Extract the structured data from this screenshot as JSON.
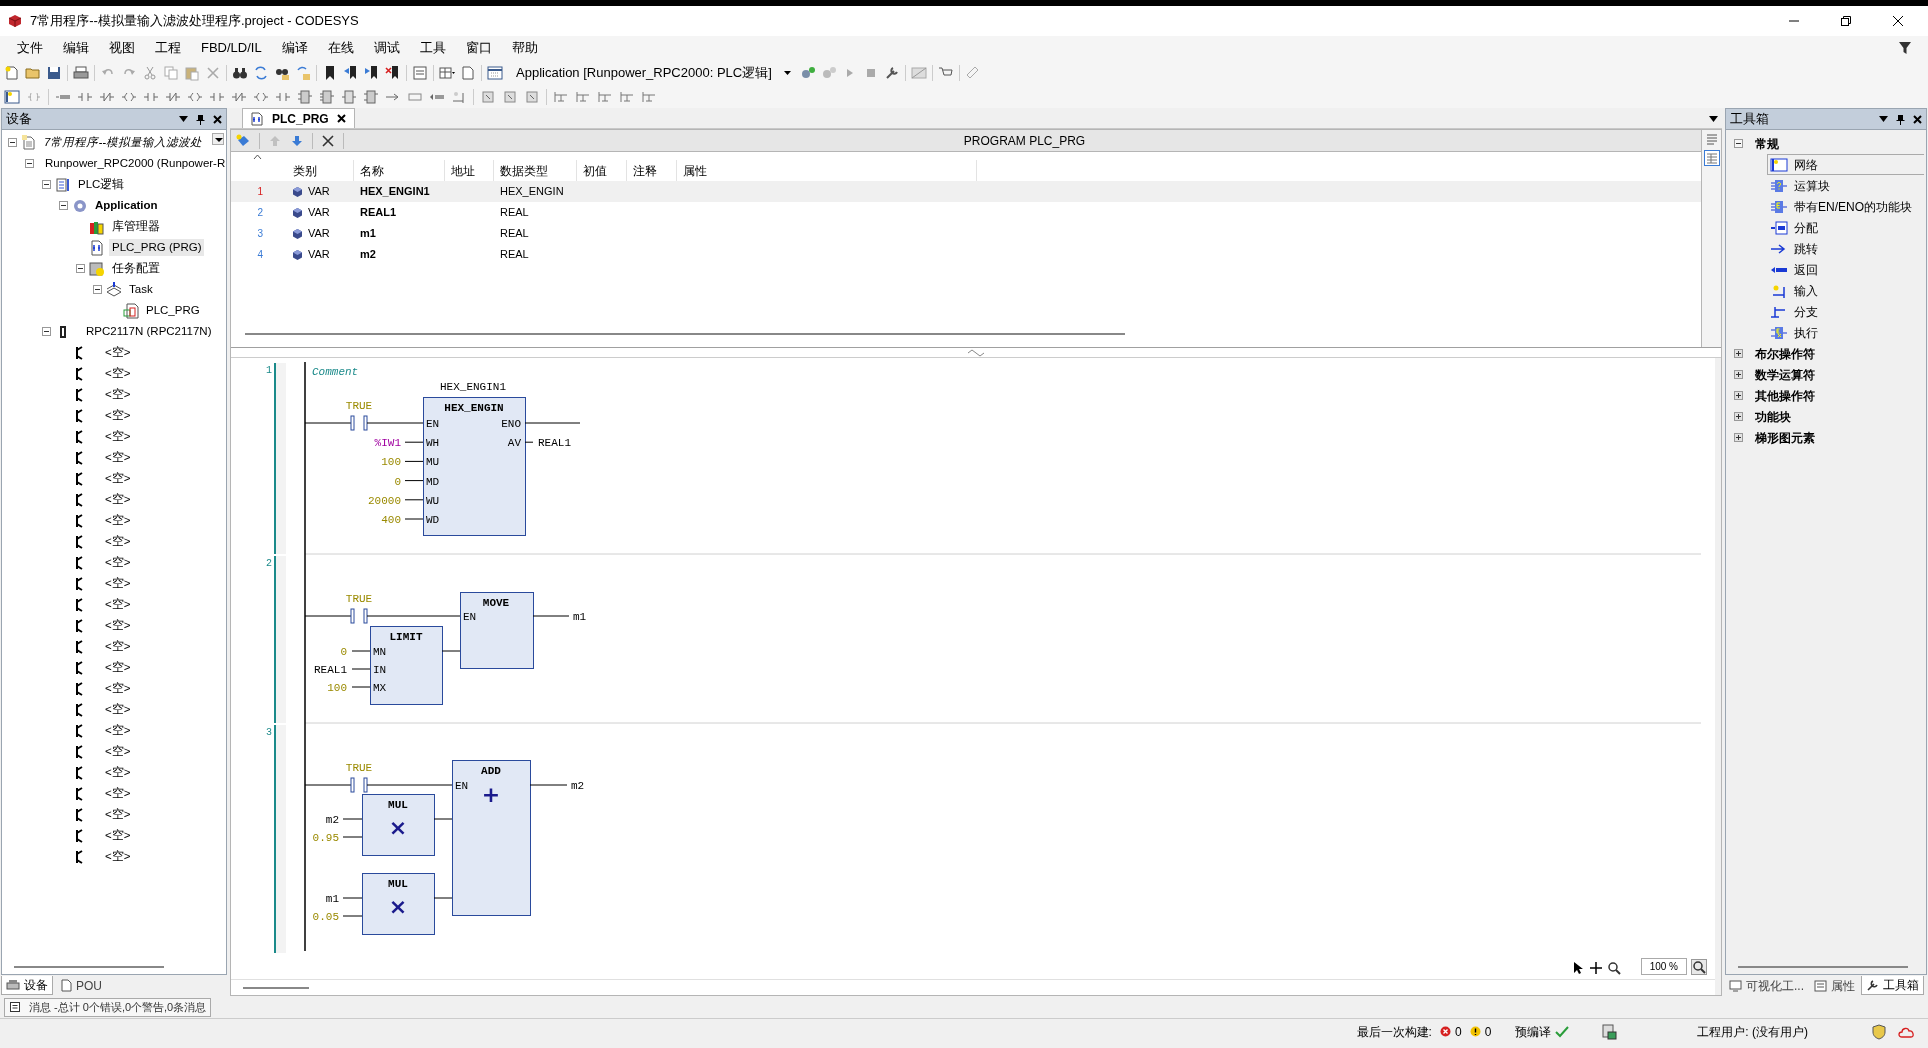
{
  "window": {
    "title": "7常用程序--模拟量输入滤波处理程序.project - CODESYS"
  },
  "menu": [
    "文件",
    "编辑",
    "视图",
    "工程",
    "FBD/LD/IL",
    "编译",
    "在线",
    "调试",
    "工具",
    "窗口",
    "帮助"
  ],
  "toolbar": {
    "application_selector": "Application [Runpower_RPC2000: PLC逻辑]"
  },
  "devices_pane": {
    "title": "设备",
    "tree": [
      {
        "label": "7常用程序--模拟量输入滤波处",
        "kind": "project",
        "expanded": true,
        "selected": false,
        "children": [
          {
            "label": "Runpower_RPC2000 (Runpower-R",
            "kind": "device",
            "expanded": true,
            "selected": false,
            "children": [
              {
                "label": "PLC逻辑",
                "kind": "plc",
                "expanded": true,
                "selected": false,
                "children": [
                  {
                    "label": "Application",
                    "kind": "application",
                    "expanded": true,
                    "selected": false,
                    "children": [
                      {
                        "label": "库管理器",
                        "kind": "library",
                        "selected": false
                      },
                      {
                        "label": "PLC_PRG (PRG)",
                        "kind": "pou",
                        "selected": true
                      },
                      {
                        "label": "任务配置",
                        "kind": "taskconfig",
                        "expanded": true,
                        "selected": false,
                        "children": [
                          {
                            "label": "Task",
                            "kind": "task",
                            "expanded": true,
                            "selected": false,
                            "children": [
                              {
                                "label": "PLC_PRG",
                                "kind": "taskcall",
                                "selected": false
                              }
                            ]
                          }
                        ]
                      }
                    ]
                  }
                ]
              },
              {
                "label": "RPC2117N (RPC2117N)",
                "kind": "module",
                "expanded": true,
                "selected": false,
                "children": [
                  {
                    "label": "<空>",
                    "kind": "slot",
                    "selected": false
                  },
                  {
                    "label": "<空>",
                    "kind": "slot",
                    "selected": false
                  },
                  {
                    "label": "<空>",
                    "kind": "slot",
                    "selected": false
                  },
                  {
                    "label": "<空>",
                    "kind": "slot",
                    "selected": false
                  },
                  {
                    "label": "<空>",
                    "kind": "slot",
                    "selected": false
                  },
                  {
                    "label": "<空>",
                    "kind": "slot",
                    "selected": false
                  },
                  {
                    "label": "<空>",
                    "kind": "slot",
                    "selected": false
                  },
                  {
                    "label": "<空>",
                    "kind": "slot",
                    "selected": false
                  },
                  {
                    "label": "<空>",
                    "kind": "slot",
                    "selected": false
                  },
                  {
                    "label": "<空>",
                    "kind": "slot",
                    "selected": false
                  },
                  {
                    "label": "<空>",
                    "kind": "slot",
                    "selected": false
                  },
                  {
                    "label": "<空>",
                    "kind": "slot",
                    "selected": false
                  },
                  {
                    "label": "<空>",
                    "kind": "slot",
                    "selected": false
                  },
                  {
                    "label": "<空>",
                    "kind": "slot",
                    "selected": false
                  },
                  {
                    "label": "<空>",
                    "kind": "slot",
                    "selected": false
                  },
                  {
                    "label": "<空>",
                    "kind": "slot",
                    "selected": false
                  },
                  {
                    "label": "<空>",
                    "kind": "slot",
                    "selected": false
                  },
                  {
                    "label": "<空>",
                    "kind": "slot",
                    "selected": false
                  },
                  {
                    "label": "<空>",
                    "kind": "slot",
                    "selected": false
                  },
                  {
                    "label": "<空>",
                    "kind": "slot",
                    "selected": false
                  },
                  {
                    "label": "<空>",
                    "kind": "slot",
                    "selected": false
                  },
                  {
                    "label": "<空>",
                    "kind": "slot",
                    "selected": false
                  },
                  {
                    "label": "<空>",
                    "kind": "slot",
                    "selected": false
                  },
                  {
                    "label": "<空>",
                    "kind": "slot",
                    "selected": false
                  },
                  {
                    "label": "<空>",
                    "kind": "slot",
                    "selected": false
                  }
                ]
              }
            ]
          }
        ]
      }
    ],
    "tabs": [
      {
        "label": "设备",
        "selected": true
      },
      {
        "label": "POU",
        "selected": false
      }
    ]
  },
  "editor": {
    "tabs": [
      {
        "label": "PLC_PRG",
        "selected": true
      }
    ],
    "header": "PROGRAM PLC_PRG",
    "declarations": {
      "columns": [
        "类别",
        "名称",
        "地址",
        "数据类型",
        "初值",
        "注释",
        "属性"
      ],
      "rows": [
        {
          "line": "1",
          "category": "VAR",
          "name": "HEX_ENGIN1",
          "data_type": "HEX_ENGIN",
          "selected": true
        },
        {
          "line": "2",
          "category": "VAR",
          "name": "REAL1",
          "data_type": "REAL",
          "selected": false
        },
        {
          "line": "3",
          "category": "VAR",
          "name": "m1",
          "data_type": "REAL",
          "selected": false
        },
        {
          "line": "4",
          "category": "VAR",
          "name": "m2",
          "data_type": "REAL",
          "selected": false
        }
      ]
    },
    "networks": [
      {
        "number": "1",
        "kind": "fb_call",
        "comment": "Comment",
        "contact": "TRUE",
        "instance": "HEX_ENGIN1",
        "block": "HEX_ENGIN",
        "inputs": [
          {
            "pin": "EN"
          },
          {
            "pin": "WH",
            "arg": "%IW1",
            "kind": "address"
          },
          {
            "pin": "MU",
            "arg": "100",
            "kind": "literal"
          },
          {
            "pin": "MD",
            "arg": "0",
            "kind": "literal"
          },
          {
            "pin": "WU",
            "arg": "20000",
            "kind": "literal"
          },
          {
            "pin": "WD",
            "arg": "400",
            "kind": "literal"
          }
        ],
        "outputs": [
          {
            "pin": "ENO"
          },
          {
            "pin": "AV",
            "arg": "REAL1",
            "kind": "variable"
          }
        ]
      },
      {
        "number": "2",
        "kind": "limit_move",
        "contact": "TRUE",
        "box": {
          "name": "MOVE",
          "en": "EN",
          "output": "m1"
        },
        "sub": {
          "name": "LIMIT",
          "inputs": [
            {
              "pin": "MN",
              "arg": "0",
              "kind": "literal"
            },
            {
              "pin": "IN",
              "arg": "REAL1",
              "kind": "variable"
            },
            {
              "pin": "MX",
              "arg": "100",
              "kind": "literal"
            }
          ]
        }
      },
      {
        "number": "3",
        "kind": "mul_add",
        "contact": "TRUE",
        "box": {
          "name": "ADD",
          "en": "EN",
          "symbol": "+",
          "output": "m2"
        },
        "subs": [
          {
            "name": "MUL",
            "symbol": "×",
            "inputs": [
              {
                "arg": "m2",
                "kind": "variable"
              },
              {
                "arg": "0.95",
                "kind": "literal"
              }
            ]
          },
          {
            "name": "MUL",
            "symbol": "×",
            "inputs": [
              {
                "arg": "m1",
                "kind": "variable"
              },
              {
                "arg": "0.05",
                "kind": "literal"
              }
            ]
          }
        ]
      }
    ],
    "zoom": "100 %"
  },
  "toolbox": {
    "title": "工具箱",
    "groups": [
      {
        "label": "常规",
        "expanded": true,
        "items": [
          {
            "label": "网络",
            "kind": "network",
            "selected": true
          },
          {
            "label": "运算块",
            "kind": "box",
            "selected": false
          },
          {
            "label": "带有EN/ENO的功能块",
            "kind": "box_en",
            "selected": false
          },
          {
            "label": "分配",
            "kind": "assign",
            "selected": false
          },
          {
            "label": "跳转",
            "kind": "jump",
            "selected": false
          },
          {
            "label": "返回",
            "kind": "return",
            "selected": false
          },
          {
            "label": "输入",
            "kind": "input",
            "selected": false
          },
          {
            "label": "分支",
            "kind": "branch",
            "selected": false
          },
          {
            "label": "执行",
            "kind": "execute",
            "selected": false
          }
        ]
      },
      {
        "label": "布尔操作符",
        "expanded": false
      },
      {
        "label": "数学运算符",
        "expanded": false
      },
      {
        "label": "其他操作符",
        "expanded": false
      },
      {
        "label": "功能块",
        "expanded": false
      },
      {
        "label": "梯形图元素",
        "expanded": false
      }
    ],
    "tabs": [
      {
        "label": "可视化工...",
        "selected": false
      },
      {
        "label": "属性",
        "selected": false
      },
      {
        "label": "工具箱",
        "selected": true
      }
    ]
  },
  "messages_tab": "消息 -总计 0个错误,0个警告,0条消息",
  "status_bar": {
    "last_build": "最后一次构建:",
    "errors": "0",
    "warnings": "0",
    "precompile": "预编译",
    "project_user": "工程用户: (没有用户)"
  }
}
